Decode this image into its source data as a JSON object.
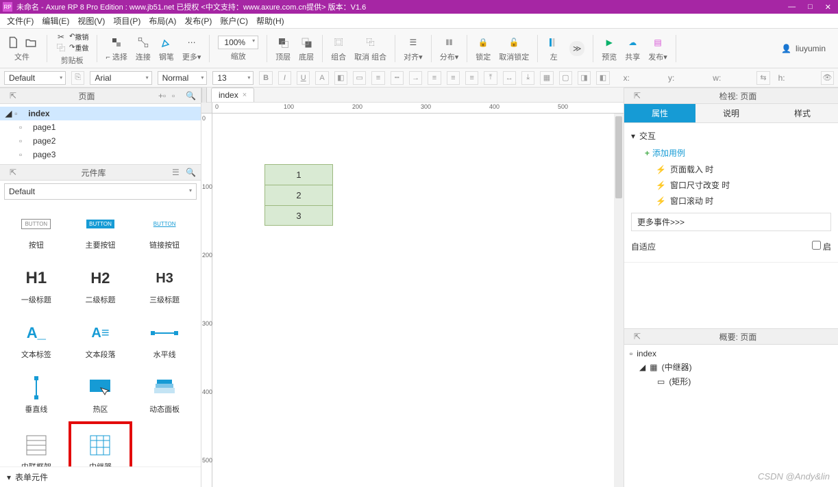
{
  "titlebar": {
    "logo": "RP",
    "text": "未命名 - Axure RP 8 Pro Edition : www.jb51.net 已授权    <中文支持：www.axure.com.cn提供> 版本：V1.6"
  },
  "menubar": [
    "文件(F)",
    "编辑(E)",
    "视图(V)",
    "项目(P)",
    "布局(A)",
    "发布(P)",
    "账户(C)",
    "帮助(H)"
  ],
  "toolbar": {
    "file_lbl": "文件",
    "clipboard_lbl": "剪贴板",
    "undo": "撤销",
    "redo": "重做",
    "select_lbl": "选择",
    "connect_lbl": "连接",
    "pen_lbl": "钢笔",
    "more_lbl": "更多",
    "zoom_value": "100%",
    "zoom_lbl": "缩放",
    "top_lbl": "顶层",
    "bottom_lbl": "底层",
    "group_lbl": "组合",
    "ungroup_lbl": "取消 组合",
    "align_lbl": "对齐",
    "distribute_lbl": "分布",
    "lock_lbl": "锁定",
    "unlock_lbl": "取消锁定",
    "left_lbl": "左",
    "preview_lbl": "预览",
    "share_lbl": "共享",
    "publish_lbl": "发布",
    "user": "liuyumin"
  },
  "toolbar2": {
    "style": "Default",
    "font": "Arial",
    "weight": "Normal",
    "size": "13",
    "x_lbl": "x:",
    "y_lbl": "y:",
    "w_lbl": "w:",
    "h_lbl": "h:"
  },
  "pages_panel": {
    "title": "页面",
    "root": "index",
    "items": [
      "page1",
      "page2",
      "page3"
    ]
  },
  "widgets_panel": {
    "title": "元件库",
    "default": "Default",
    "widgets": [
      {
        "icon": "btn-rect",
        "label": "按钮"
      },
      {
        "icon": "btn-primary",
        "label": "主要按钮"
      },
      {
        "icon": "btn-link",
        "label": "链接按钮"
      },
      {
        "icon": "h1",
        "label": "一级标题"
      },
      {
        "icon": "h2",
        "label": "二级标题"
      },
      {
        "icon": "h3",
        "label": "三级标题"
      },
      {
        "icon": "text-label",
        "label": "文本标签"
      },
      {
        "icon": "text-para",
        "label": "文本段落"
      },
      {
        "icon": "hline",
        "label": "水平线"
      },
      {
        "icon": "vline",
        "label": "垂直线"
      },
      {
        "icon": "hotspot",
        "label": "热区"
      },
      {
        "icon": "dynpanel",
        "label": "动态面板"
      },
      {
        "icon": "iframe",
        "label": "内联框架"
      },
      {
        "icon": "repeater",
        "label": "中继器"
      }
    ],
    "form_section": "表单元件"
  },
  "canvas": {
    "tab": "index",
    "ruler_h": [
      "0",
      "100",
      "200",
      "300",
      "400",
      "500"
    ],
    "ruler_v": [
      "0",
      "100",
      "200",
      "300",
      "400",
      "500"
    ],
    "repeater_rows": [
      "1",
      "2",
      "3"
    ]
  },
  "inspector": {
    "header": "检视: 页面",
    "tabs": [
      "属性",
      "说明",
      "样式"
    ],
    "interactions": "交互",
    "add_case": "添加用例",
    "events": [
      "页面载入 时",
      "窗口尺寸改变 时",
      "窗口滚动 时"
    ],
    "more_events": "更多事件>>>",
    "adaptive": "自适应",
    "adaptive_chk": "启"
  },
  "outline": {
    "header": "概要: 页面",
    "root": "index",
    "repeater": "(中继器)",
    "rect": "(矩形)"
  },
  "watermark": "CSDN @Andy&lin"
}
